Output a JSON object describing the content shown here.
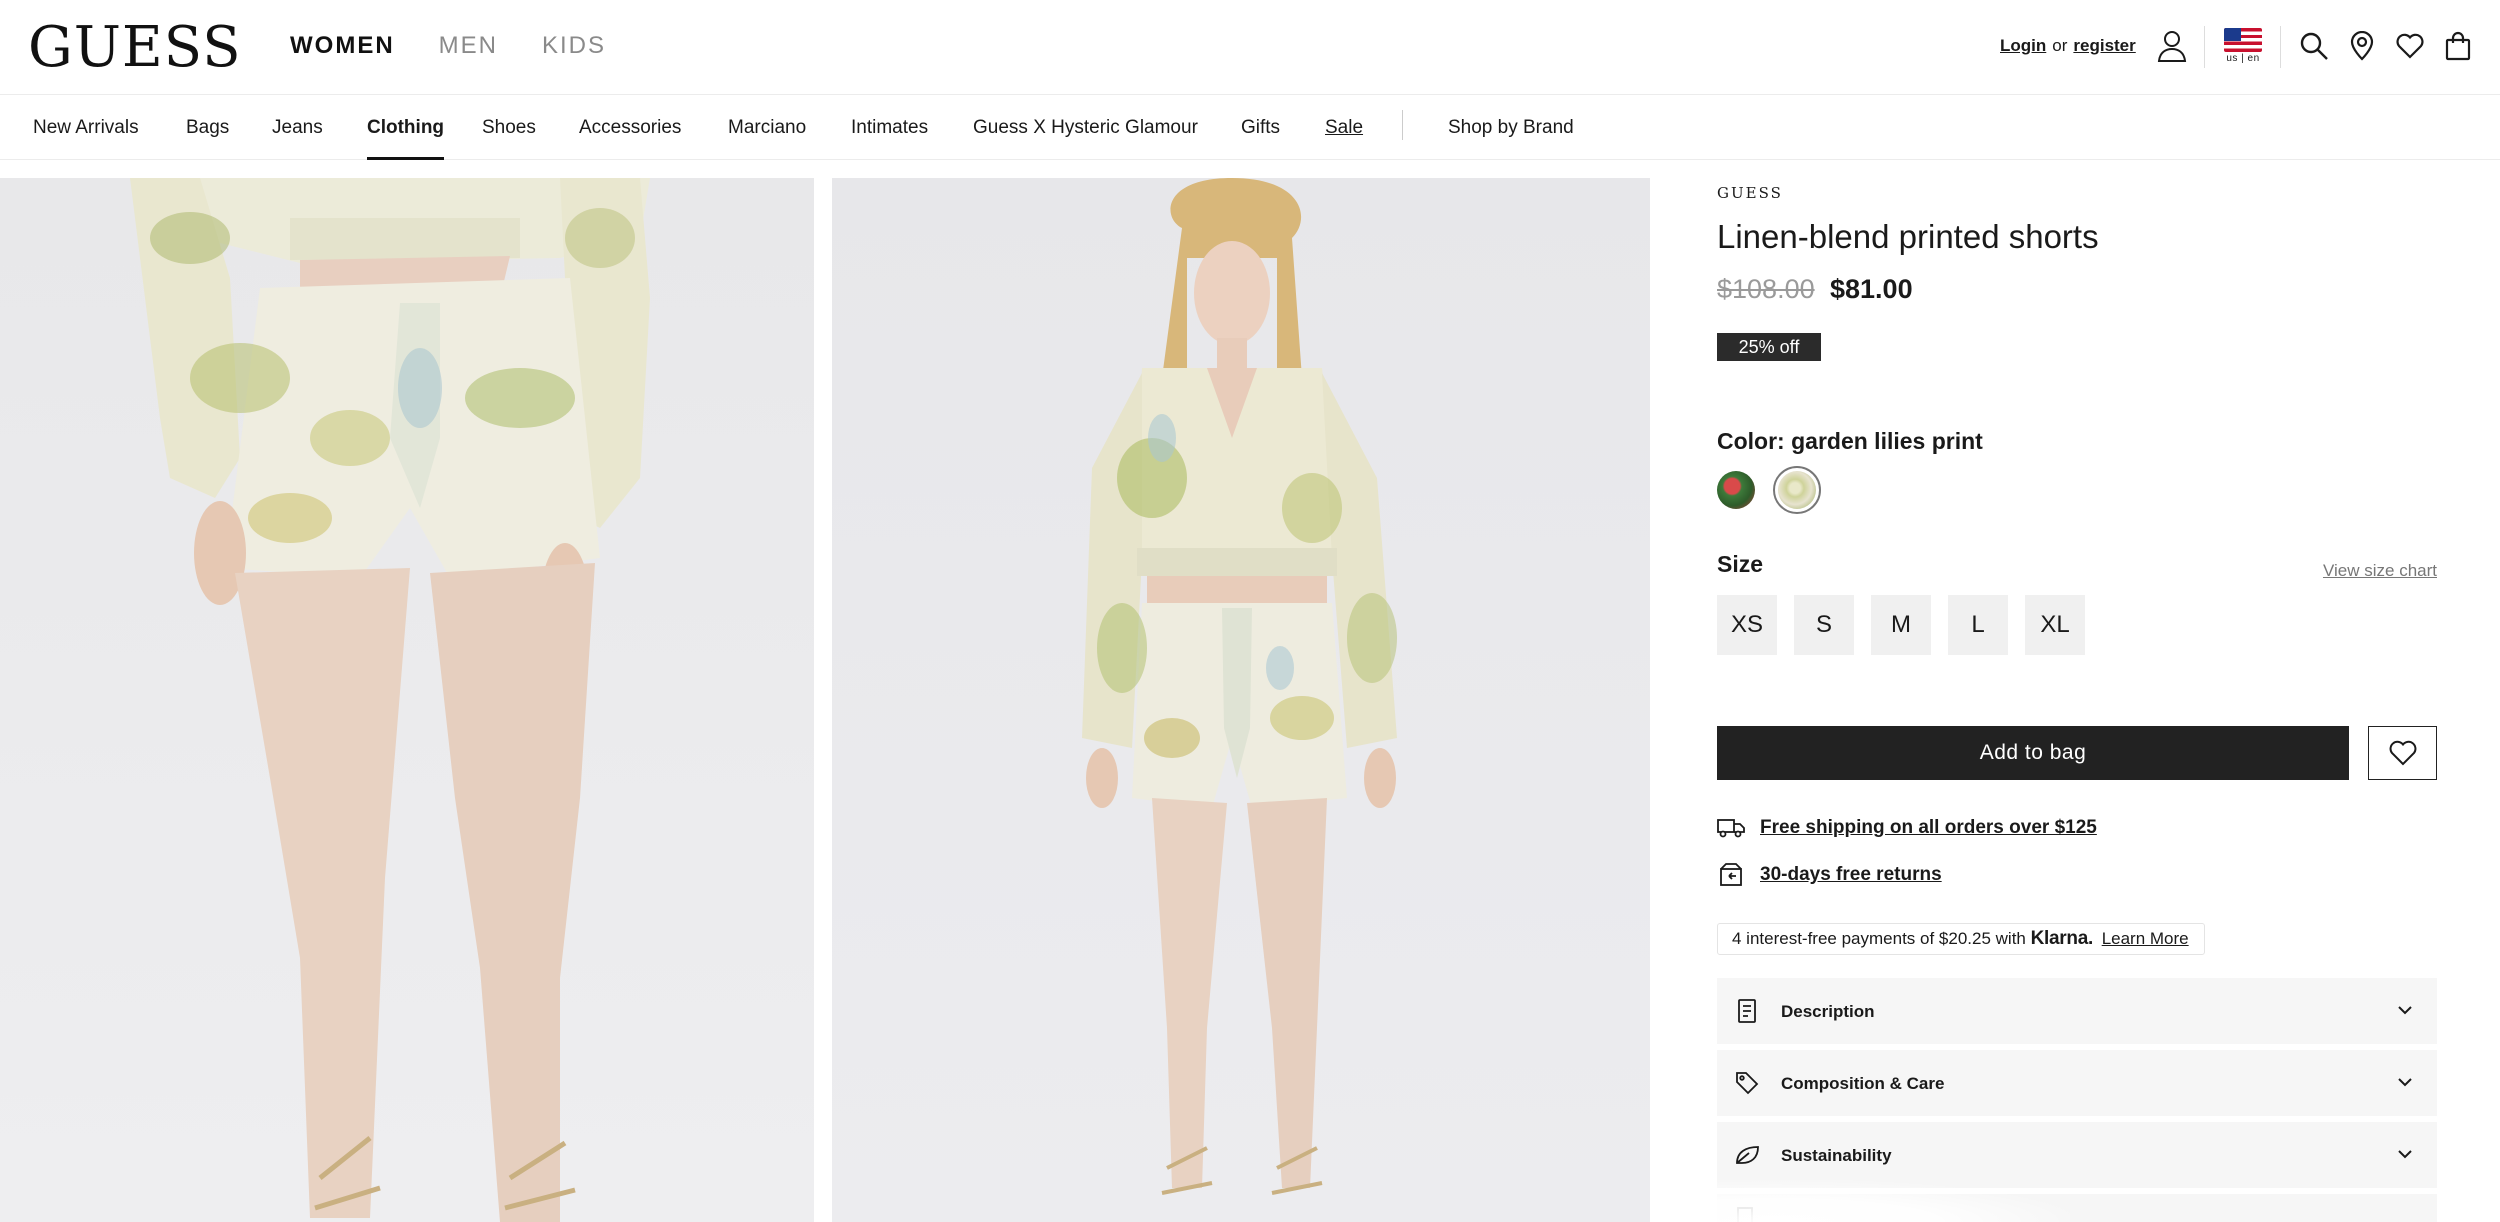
{
  "header": {
    "logo": "GUESS",
    "gender_tabs": [
      {
        "label": "WOMEN",
        "active": true
      },
      {
        "label": "MEN",
        "active": false
      },
      {
        "label": "KIDS",
        "active": false
      }
    ],
    "login_label": "Login",
    "or_label": "or",
    "register_label": "register",
    "locale": "us | en",
    "icons": [
      "user-icon",
      "flag-icon",
      "search-icon",
      "store-locator-icon",
      "wishlist-icon",
      "bag-icon"
    ]
  },
  "category_nav": {
    "items": [
      {
        "label": "New Arrivals"
      },
      {
        "label": "Bags"
      },
      {
        "label": "Jeans"
      },
      {
        "label": "Clothing",
        "active": true
      },
      {
        "label": "Shoes"
      },
      {
        "label": "Accessories"
      },
      {
        "label": "Marciano"
      },
      {
        "label": "Intimates"
      },
      {
        "label": "Guess X Hysteric Glamour"
      },
      {
        "label": "Gifts"
      },
      {
        "label": "Sale"
      }
    ],
    "shop_by_brand": "Shop by Brand"
  },
  "product": {
    "brand": "GUESS",
    "title": "Linen-blend printed shorts",
    "original_price": "$108.00",
    "sale_price": "$81.00",
    "discount_badge": "25% off",
    "color_label": "Color:",
    "color_value": "garden lilies print",
    "size_label": "Size",
    "size_chart_link": "View size chart",
    "sizes": [
      "XS",
      "S",
      "M",
      "L",
      "XL"
    ],
    "add_to_bag": "Add to bag",
    "perks": [
      {
        "icon": "truck-icon",
        "label": "Free shipping on all orders over $125"
      },
      {
        "icon": "return-box-icon",
        "label": "30-days free returns"
      }
    ],
    "klarna": {
      "text": "4 interest-free payments of $20.25 with",
      "brand": "Klarna.",
      "link": "Learn More"
    },
    "accordions": [
      {
        "icon": "document-icon",
        "label": "Description"
      },
      {
        "icon": "tag-icon",
        "label": "Composition & Care"
      },
      {
        "icon": "leaf-icon",
        "label": "Sustainability"
      }
    ]
  },
  "colors": {
    "accent": "#222222",
    "sale_badge_bg": "#2b2b2b",
    "muted_text": "#9a9a9a"
  }
}
